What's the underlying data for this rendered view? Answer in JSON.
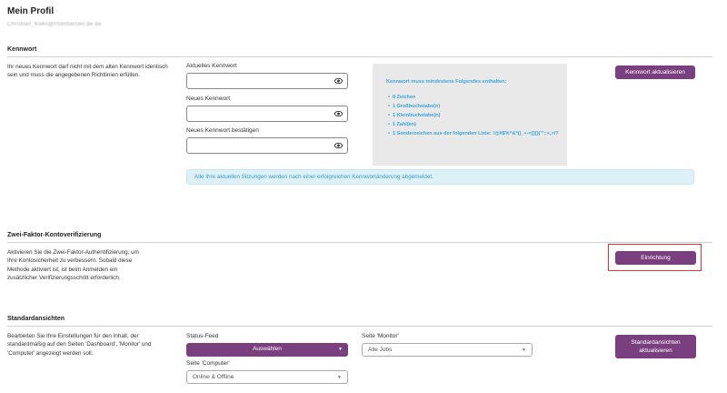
{
  "page": {
    "title": "Mein Profil",
    "subtitle": "Christian_Koell@ritterbarcelt.de de"
  },
  "password": {
    "heading": "Kennwort",
    "description": "Ihr neues Kennwort darf nicht mit dem alten Kennwort identisch sein und muss die angegebenen Richtlinien erfüllen.",
    "current_label": "Aktuelles Kennwort",
    "new_label": "Neues Kennwort",
    "confirm_label": "Neues Kennwort bestätigen",
    "requirements_title": "Kennwort muss mindestens Folgendes enthalten:",
    "requirements": [
      "8 Zeichen",
      "1 Großbuchstabe(n)",
      "1 Kleinbuchstabe(n)",
      "1 Zahl(en)",
      "1 Sonderzeichen aus der folgenden Liste: !@#$%^&*()_+-=[]{}|\"';:<,>/?"
    ],
    "update_button": "Kennwort aktualisieren",
    "info_text": "Alle Ihre aktuellen Sitzungen werden nach einer erfolgreichen Kennwortänderung abgemeldet."
  },
  "two_factor": {
    "heading": "Zwei-Faktor-Kontoverifizierung",
    "description": "Aktivieren Sie die Zwei-Faktor-Authentifizierung, um Ihre Kontosicherheit zu verbessern. Sobald diese Methode aktiviert ist, ist beim Anmelden ein zusätzlicher Verifizierungsschritt erforderlich.",
    "setup_button": "Einrichtung"
  },
  "default_views": {
    "heading": "Standardansichten",
    "description": "Bearbeiten Sie Ihre Einstellungen für den Inhalt, der standardmäßig auf den Seiten 'Dashboard', 'Monitor' und 'Computer' angezeigt werden soll.",
    "status_feed_label": "Status-Feed",
    "status_feed_value": "Auswählen",
    "monitor_label": "Seite 'Monitor'",
    "monitor_value": "Alle Jobs",
    "computer_label": "Seite 'Computer'",
    "computer_value": "Online & Offline",
    "update_button": "Standardansichten aktualisieren"
  },
  "colors": {
    "accent": "#7a3f7e",
    "info_text": "#3d9cc8",
    "highlight": "#e03333"
  }
}
